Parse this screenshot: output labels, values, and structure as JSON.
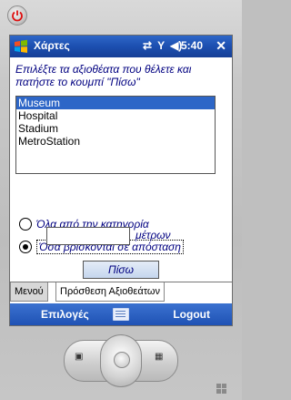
{
  "titlebar": {
    "title": "Χάρτες",
    "clock": "5:40",
    "close": "✕"
  },
  "content": {
    "instruction": "Επιλέξτε τα αξιοθέατα που θέλετε και πατήστε το κουμπί \"Πίσω\"",
    "list": [
      "Museum",
      "Hospital",
      "Stadium",
      "MetroStation"
    ],
    "list_selected_index": 0,
    "radio_all_label": "Όλα από την κατηγορία",
    "radio_distance_label": "Όσα βρίσκονται σε απόσταση",
    "distance_value": "",
    "meters_label": "μέτρων",
    "back_label": "Πίσω"
  },
  "tabs": {
    "menu": "Μενού",
    "add_sights": "Πρόσθεση Αξιοθεάτων"
  },
  "softkeys": {
    "left": "Επιλογές",
    "right": "Logout"
  }
}
